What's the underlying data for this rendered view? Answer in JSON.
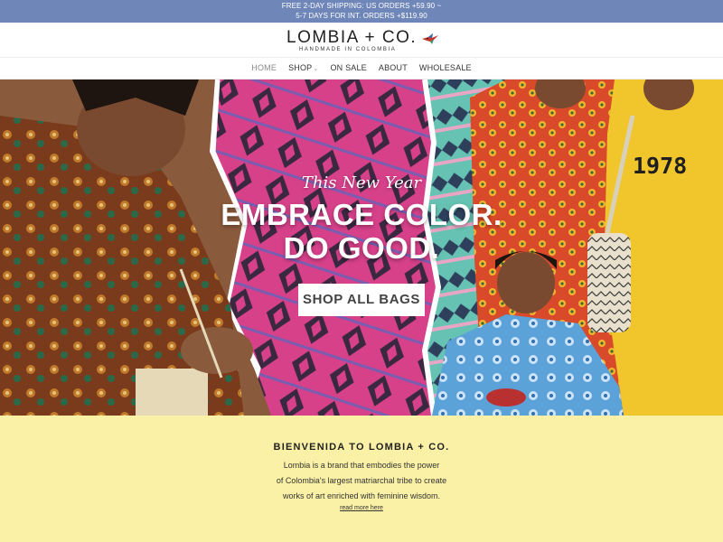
{
  "announcement": {
    "line1": "FREE 2-DAY SHIPPING: US ORDERS +59.90 ~",
    "line2": "5-7 DAYS FOR INT. ORDERS +$119.90"
  },
  "brand": {
    "name": "LOMBIA + CO.",
    "tagline": "HANDMADE IN COLOMBIA",
    "icon": "hummingbird-icon"
  },
  "nav": {
    "items": [
      {
        "label": "HOME",
        "active": true
      },
      {
        "label": "SHOP",
        "dropdown": true
      },
      {
        "label": "ON SALE"
      },
      {
        "label": "ABOUT"
      },
      {
        "label": "WHOLESALE"
      }
    ]
  },
  "hero": {
    "script": "This New Year",
    "title_line1": "EMBRACE COLOR.",
    "title_line2": "DO GOOD.",
    "cta": "SHOP ALL BAGS",
    "shirt_text": "1978"
  },
  "welcome": {
    "heading": "BIENVENIDA TO LOMBIA + CO.",
    "line1": "Lombia is a brand that embodies the power",
    "line2": "of Colombia's largest matriarchal tribe to create",
    "line3": "works of art enriched with feminine wisdom.",
    "link": "read more here"
  },
  "colors": {
    "announcement_bg": "#6f86b9",
    "welcome_bg": "#faf1a6",
    "accent_pink": "#d6418a",
    "accent_teal": "#6cb8a6"
  }
}
